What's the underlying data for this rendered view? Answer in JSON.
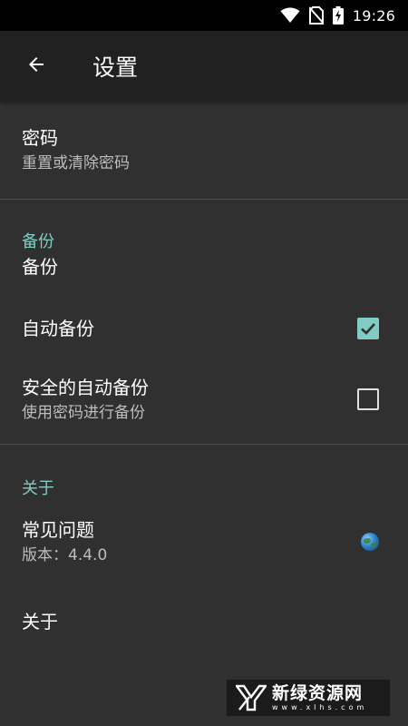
{
  "status_bar": {
    "time": "19:26",
    "icons": [
      "wifi-icon",
      "no-sim-icon",
      "battery-charging-icon"
    ]
  },
  "app_bar": {
    "back_icon": "arrow-back-icon",
    "title": "设置"
  },
  "preferences": {
    "password": {
      "title": "密码",
      "summary": "重置或清除密码"
    },
    "backup_section": {
      "header": "备份"
    },
    "backup": {
      "title": "备份"
    },
    "auto_backup": {
      "title": "自动备份",
      "checked": true
    },
    "secure_auto_backup": {
      "title": "安全的自动备份",
      "summary": "使用密码进行备份",
      "checked": false
    },
    "about_section": {
      "header": "关于"
    },
    "faq": {
      "title": "常见问题",
      "summary": "版本：4.4.0",
      "icon": "globe-icon"
    },
    "about": {
      "title": "关于"
    }
  },
  "watermark": {
    "name": "新绿资源网",
    "url": "www.xlhs.com"
  },
  "colors": {
    "accent": "#80cbc4",
    "background": "#303030",
    "app_bar": "#212121",
    "status_bar": "#000000"
  }
}
